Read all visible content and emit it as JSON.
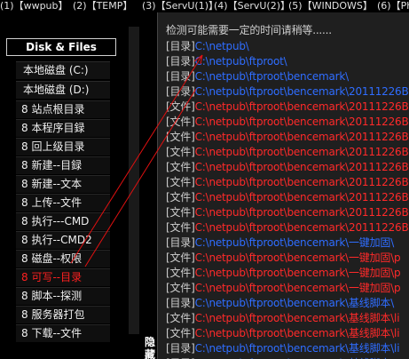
{
  "tabs": [
    "(1)【wwpub】",
    "(2)【TEMP】",
    "(3)【ServU(1)】",
    "(4)【ServU(2)】",
    "(5)【WINDOWS】",
    "(6)【Ph"
  ],
  "sidebar": {
    "disk_header": "Disk & Files",
    "disks": [
      "本地磁盘 (C:)",
      "本地磁盘 (D:)"
    ],
    "menu": [
      "8 站点根目录",
      "8 本程序目録",
      "8 回上级目录",
      "8 新建--目録",
      "8 新建--文本",
      "8 上传--文件",
      "8 执行---CMD",
      "8 执行--CMD2",
      "8 磁盘--权限",
      "8 可写--目录",
      "8 脚本--探测",
      "8 服务器打包",
      "8 下载--文件"
    ],
    "active_menu_index": 9
  },
  "hide_button": "隐藏",
  "content": {
    "header": "检测可能需要一定的时间请稍等......",
    "lines": [
      {
        "tag": "[目录]",
        "path": "C:\\netpub\\",
        "color": "blue"
      },
      {
        "tag": "[目录]",
        "path": "C:\\netpub\\ftproot\\",
        "color": "blue"
      },
      {
        "tag": "[目录]",
        "path": "C:\\netpub\\ftproot\\bencemark\\",
        "color": "blue"
      },
      {
        "tag": "[目录]",
        "path": "C:\\netpub\\ftproot\\bencemark\\20111226B",
        "color": "blue"
      },
      {
        "tag": "[文件]",
        "path": "C:\\netpub\\ftproot\\bencemark\\20111226B",
        "color": "red"
      },
      {
        "tag": "[文件]",
        "path": "C:\\netpub\\ftproot\\bencemark\\20111226B",
        "color": "red"
      },
      {
        "tag": "[文件]",
        "path": "C:\\netpub\\ftproot\\bencemark\\20111226B",
        "color": "red"
      },
      {
        "tag": "[文件]",
        "path": "C:\\netpub\\ftproot\\bencemark\\20111226B",
        "color": "red"
      },
      {
        "tag": "[文件]",
        "path": "C:\\netpub\\ftproot\\bencemark\\20111226B",
        "color": "red"
      },
      {
        "tag": "[文件]",
        "path": "C:\\netpub\\ftproot\\bencemark\\20111226B",
        "color": "red"
      },
      {
        "tag": "[文件]",
        "path": "C:\\netpub\\ftproot\\bencemark\\20111226B",
        "color": "red"
      },
      {
        "tag": "[文件]",
        "path": "C:\\netpub\\ftproot\\bencemark\\20111226B",
        "color": "red"
      },
      {
        "tag": "[文件]",
        "path": "C:\\netpub\\ftproot\\bencemark\\20111226B",
        "color": "red"
      },
      {
        "tag": "[目录]",
        "path": "C:\\netpub\\ftproot\\bencemark\\一键加固\\",
        "color": "blue"
      },
      {
        "tag": "[文件]",
        "path": "C:\\netpub\\ftproot\\bencemark\\一键加固\\p",
        "color": "red"
      },
      {
        "tag": "[文件]",
        "path": "C:\\netpub\\ftproot\\bencemark\\一键加固\\p",
        "color": "red"
      },
      {
        "tag": "[文件]",
        "path": "C:\\netpub\\ftproot\\bencemark\\一键加固\\p",
        "color": "red"
      },
      {
        "tag": "[目录]",
        "path": "C:\\netpub\\ftproot\\bencemark\\基线脚本\\",
        "color": "blue"
      },
      {
        "tag": "[文件]",
        "path": "C:\\netpub\\ftproot\\bencemark\\基线脚本\\li",
        "color": "red"
      },
      {
        "tag": "[文件]",
        "path": "C:\\netpub\\ftproot\\bencemark\\基线脚本\\li",
        "color": "red"
      },
      {
        "tag": "[目录]",
        "path": "C:\\netpub\\ftproot\\bencemark\\基线脚本\\li",
        "color": "blue"
      },
      {
        "tag": "[目录]",
        "path": "C:\\netpub\\ftproot\\bencemark\\基线脚本\\",
        "color": "blue"
      }
    ]
  },
  "colors": {
    "background": "#000000",
    "content_bg": "#1f1f1f",
    "dir_blue": "#2f6dff",
    "file_red": "#ff2a2a",
    "active_red": "#ff2020"
  }
}
